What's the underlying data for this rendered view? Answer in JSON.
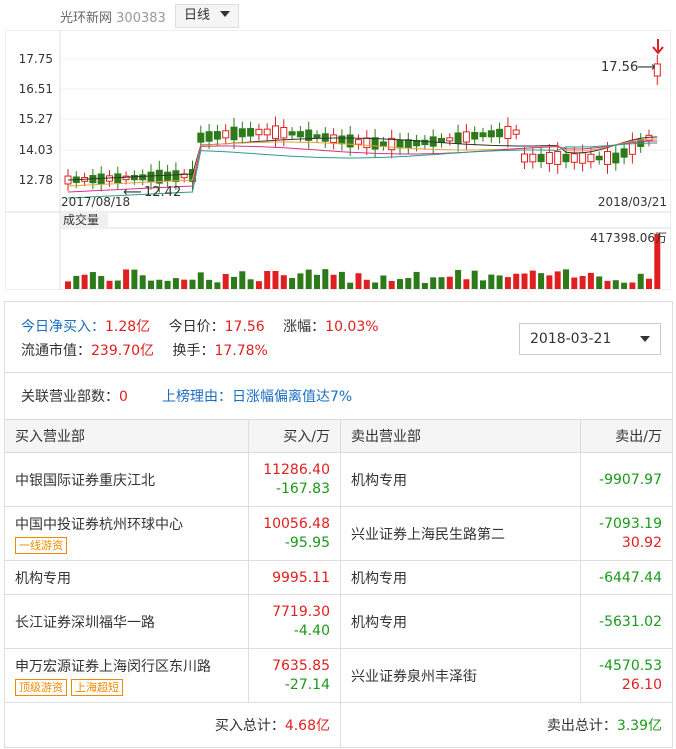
{
  "header": {
    "stock_name": "光环新网",
    "stock_code": "300383",
    "period": "日线"
  },
  "chart": {
    "price_axis": [
      "17.75",
      "16.51",
      "15.27",
      "14.03",
      "12.78"
    ],
    "start_date": "2017/08/18",
    "end_date": "2018/03/21",
    "high_label": "17.56",
    "low_label": "12.42",
    "volume_title": "成交量",
    "volume_max": "417398.06万",
    "colors": {
      "up": "#e02020",
      "down": "#2c7a1a"
    }
  },
  "info": {
    "net_buy_label": "今日净买入：",
    "net_buy_value": "1.28亿",
    "price_label": "今日价：",
    "price_value": "17.56",
    "change_label": "涨幅：",
    "change_value": "10.03%",
    "mcap_label": "流通市值：",
    "mcap_value": "239.70亿",
    "turnover_label": "换手：",
    "turnover_value": "17.78%",
    "date": "2018-03-21"
  },
  "summary": {
    "related_label": "关联营业部数：",
    "related_value": "0",
    "reason": "上榜理由：日涨幅偏离值达7%"
  },
  "table": {
    "headers": {
      "buy_dept": "买入营业部",
      "buy_amt": "买入/万",
      "sell_dept": "卖出营业部",
      "sell_amt": "卖出/万"
    },
    "rows": [
      {
        "buy_name": "中银国际证券重庆江北",
        "buy_tags": [],
        "buy_v1": "11286.40",
        "buy_v2": "-167.83",
        "sell_name": "机构专用",
        "sell_v1": "-9907.97",
        "sell_v2": ""
      },
      {
        "buy_name": "中国中投证券杭州环球中心",
        "buy_tags": [
          "一线游资"
        ],
        "buy_v1": "10056.48",
        "buy_v2": "-95.95",
        "sell_name": "兴业证券上海民生路第二",
        "sell_v1": "-7093.19",
        "sell_v2": "30.92"
      },
      {
        "buy_name": "机构专用",
        "buy_tags": [],
        "buy_v1": "9995.11",
        "buy_v2": "",
        "sell_name": "机构专用",
        "sell_v1": "-6447.44",
        "sell_v2": ""
      },
      {
        "buy_name": "长江证券深圳福华一路",
        "buy_tags": [],
        "buy_v1": "7719.30",
        "buy_v2": "-4.40",
        "sell_name": "机构专用",
        "sell_v1": "-5631.02",
        "sell_v2": ""
      },
      {
        "buy_name": "申万宏源证券上海闵行区东川路",
        "buy_tags": [
          "顶级游资",
          "上海超短"
        ],
        "buy_v1": "7635.85",
        "buy_v2": "-27.14",
        "sell_name": "兴业证券泉州丰泽街",
        "sell_v1": "-4570.53",
        "sell_v2": "26.10"
      }
    ],
    "buy_total_label": "买入总计：",
    "buy_total": "4.68亿",
    "sell_total_label": "卖出总计：",
    "sell_total": "3.39亿"
  }
}
